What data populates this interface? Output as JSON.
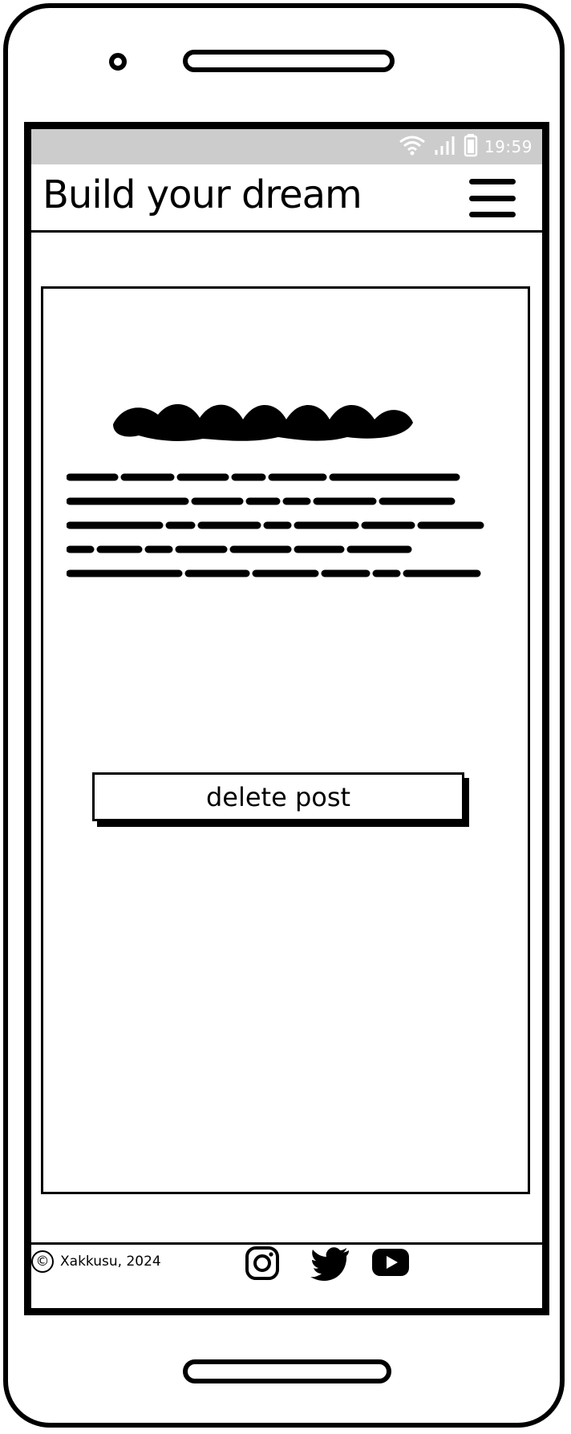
{
  "status_bar": {
    "time": "19:59",
    "icons": [
      "wifi-icon",
      "signal-icon",
      "battery-icon"
    ]
  },
  "header": {
    "title": "Build your dream",
    "menu_icon": "hamburger-menu-icon"
  },
  "post": {
    "delete_label": "delete post"
  },
  "footer": {
    "copyright_symbol": "©",
    "copyright_text": "Xakkusu, 2024",
    "social_icons": [
      "instagram-icon",
      "twitter-icon",
      "youtube-icon"
    ]
  },
  "colors": {
    "status_bar_bg": "#cccccc",
    "ink": "#000000",
    "background": "#ffffff"
  }
}
